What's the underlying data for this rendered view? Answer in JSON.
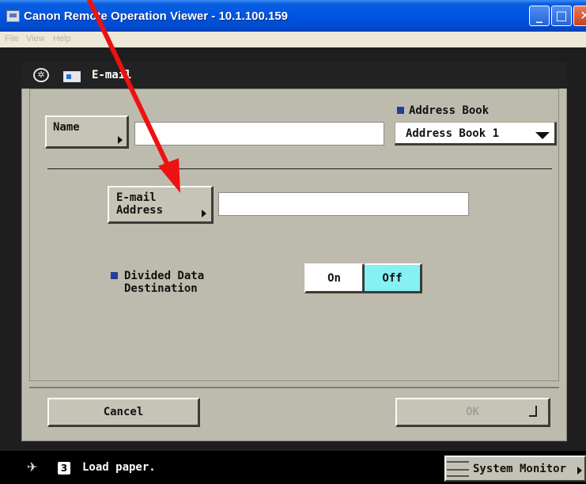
{
  "window": {
    "title": "Canon Remote Operation Viewer - 10.1.100.159",
    "minimize_glyph": "_",
    "maximize_glyph": "□",
    "close_glyph": "✕"
  },
  "menubar": {
    "file": "File",
    "view": "View",
    "help": "Help"
  },
  "screen": {
    "title": "E-mail",
    "home_icon_glyph": "✲",
    "name_button": "Name",
    "address_book_label": "Address Book",
    "address_book_value": "Address Book 1",
    "email_button_line1": "E-mail",
    "email_button_line2": "Address",
    "name_value": "",
    "email_value": "",
    "divided_label_line1": "Divided Data",
    "divided_label_line2": "Destination",
    "toggle": {
      "on": "On",
      "off": "Off",
      "selected": "Off"
    },
    "cancel": "Cancel",
    "ok": "OK"
  },
  "statusbar": {
    "number": "3",
    "message": "Load paper.",
    "system_monitor": "System Monitor"
  },
  "colors": {
    "title_bar": "#0054e3",
    "screen_bg": "#bdbbad",
    "selected_toggle": "#86f1f3",
    "bullet": "#243c9c",
    "annotation_arrow": "#ee1111"
  }
}
